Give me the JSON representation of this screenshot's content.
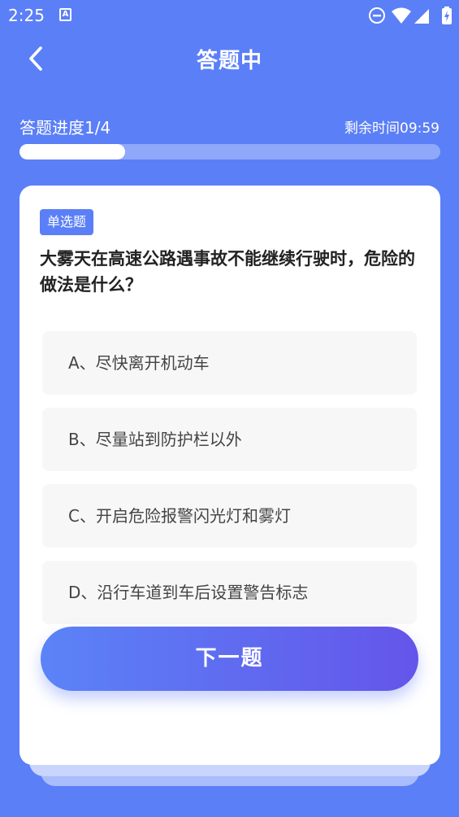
{
  "status_bar": {
    "time": "2:25",
    "notification_icon": "A"
  },
  "header": {
    "title": "答题中",
    "back_icon": "chevron-left-icon"
  },
  "progress": {
    "label": "答题进度1/4",
    "time_left": "剩余时间09:59",
    "fraction": 0.25
  },
  "question": {
    "type": "单选题",
    "text": "大雾天在高速公路遇事故不能继续行驶时，危险的做法是什么？",
    "options": [
      "A、尽快离开机动车",
      "B、尽量站到防护栏以外",
      "C、开启危险报警闪光灯和雾灯",
      "D、沿行车道到车后设置警告标志"
    ]
  },
  "next_button": "下一题",
  "colors": {
    "background": "#5b7ff7",
    "accent_gradient_start": "#5b83f7",
    "accent_gradient_end": "#6455ea",
    "option_bg": "#f7f7f7"
  }
}
